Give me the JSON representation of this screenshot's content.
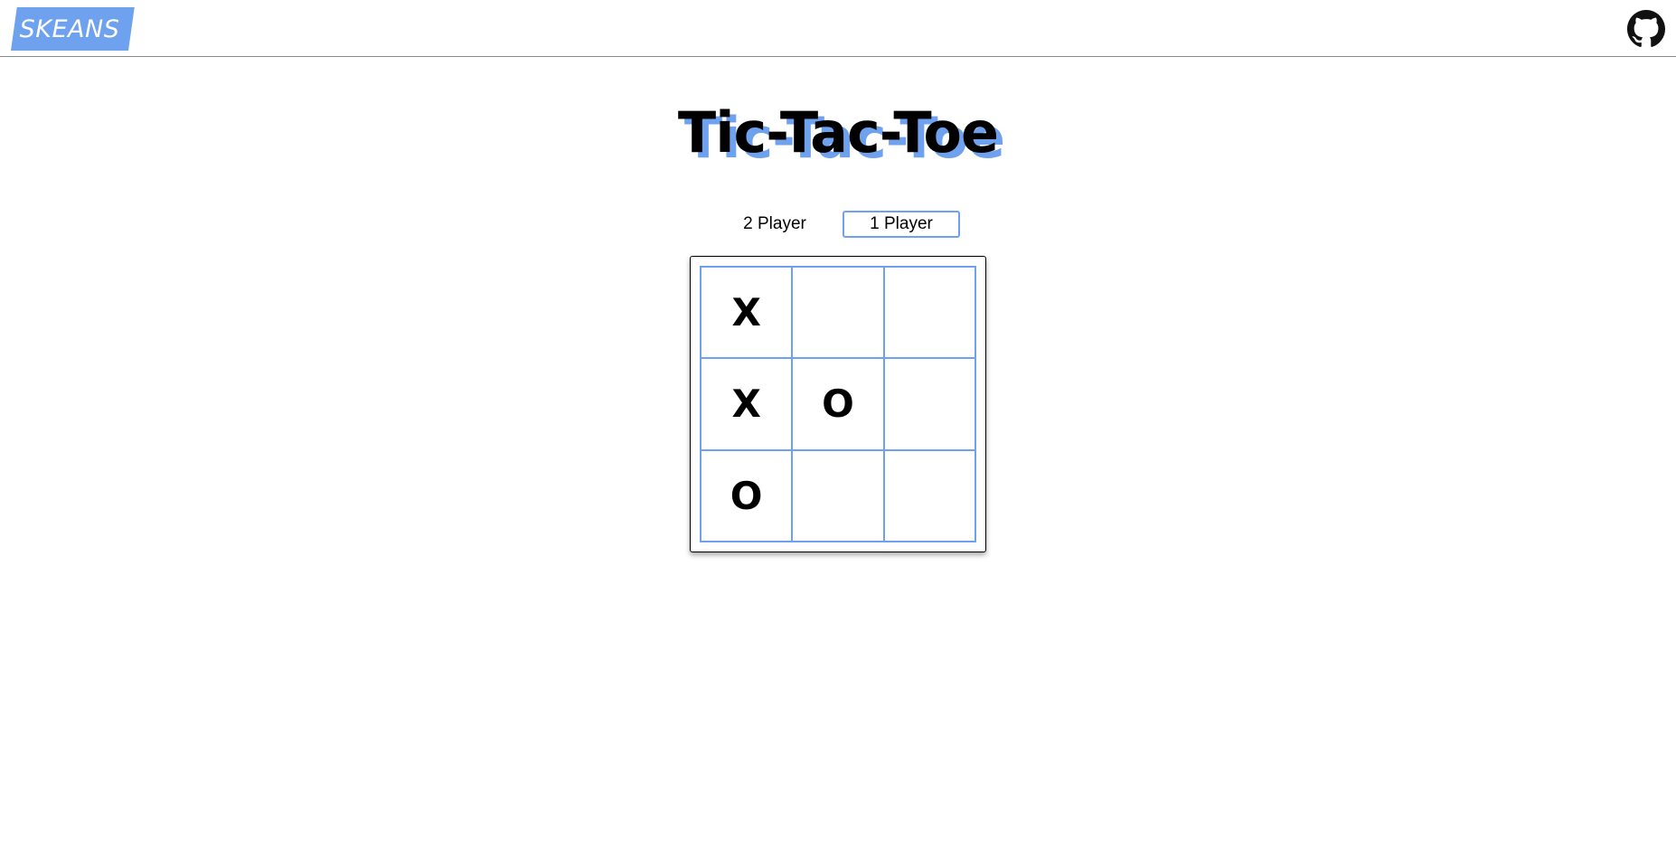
{
  "header": {
    "logo_text": "SKEANS",
    "github_icon": "github-icon",
    "accent_color": "#6ea1ee"
  },
  "page": {
    "title": "Tic-Tac-Toe"
  },
  "modes": {
    "two_player": "2 Player",
    "one_player": "1 Player",
    "selected": "1 Player"
  },
  "board": {
    "cells": [
      "X",
      "",
      "",
      "X",
      "O",
      "",
      "O",
      "",
      ""
    ]
  }
}
